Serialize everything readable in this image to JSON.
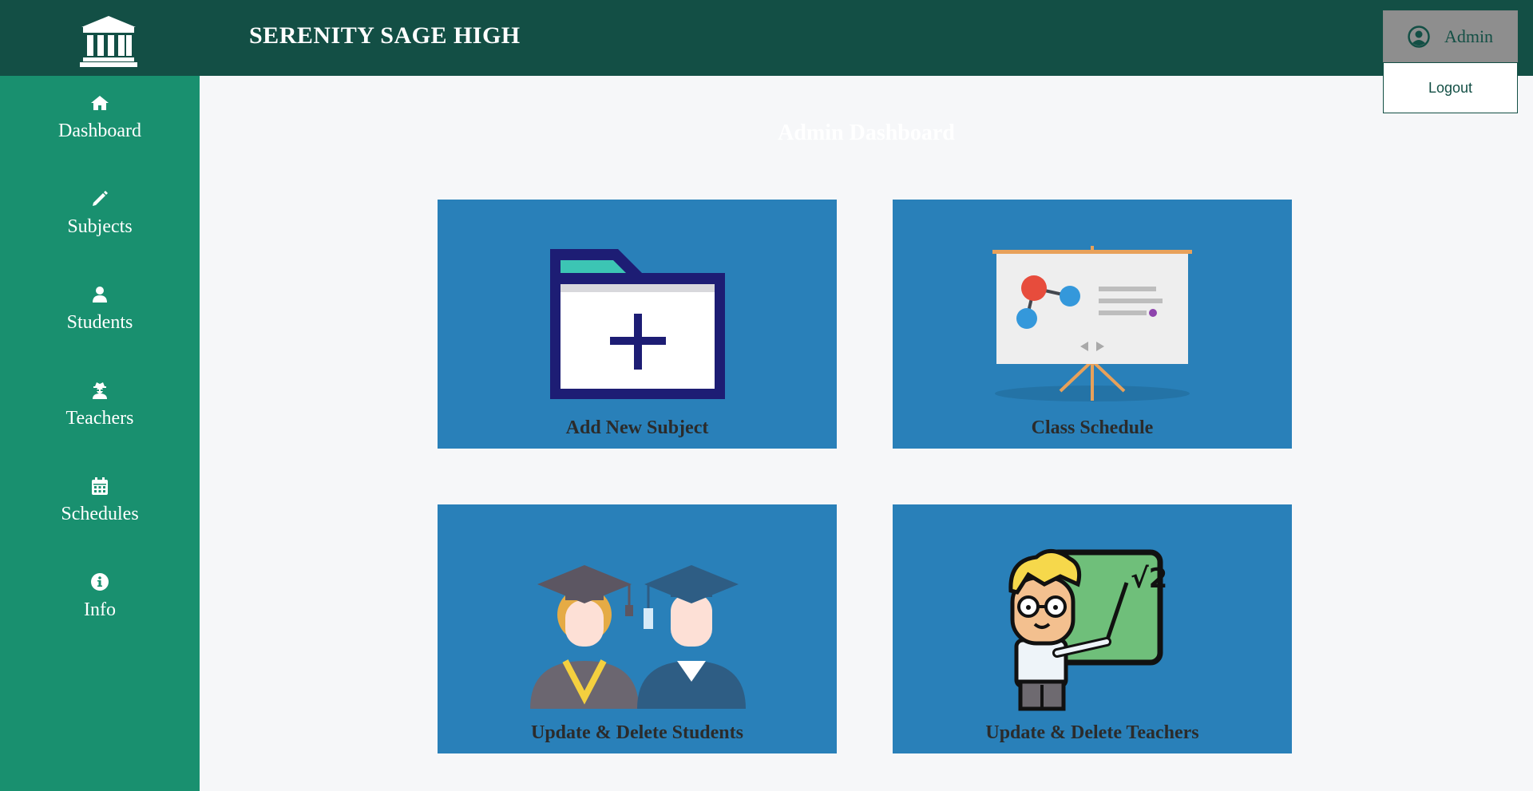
{
  "header": {
    "school_name": "SERENITY SAGE HIGH",
    "user_label": "Admin",
    "logout_label": "Logout",
    "icons": {
      "logo": "bank-building-icon",
      "user": "user-circle-icon"
    }
  },
  "sidebar": {
    "items": [
      {
        "label": "Dashboard",
        "icon": "home-icon"
      },
      {
        "label": "Subjects",
        "icon": "pencil-icon"
      },
      {
        "label": "Students",
        "icon": "user-icon"
      },
      {
        "label": "Teachers",
        "icon": "user-secret-icon"
      },
      {
        "label": "Schedules",
        "icon": "calendar-icon"
      },
      {
        "label": "Info",
        "icon": "info-icon"
      }
    ]
  },
  "main": {
    "title": "Admin Dashboard",
    "cards": [
      {
        "label": "Add New Subject",
        "image": "add-folder-illustration"
      },
      {
        "label": "Class Schedule",
        "image": "presentation-board-illustration"
      },
      {
        "label": "Update & Delete Students",
        "image": "graduates-illustration"
      },
      {
        "label": "Update & Delete Teachers",
        "image": "teacher-chalkboard-illustration"
      }
    ]
  },
  "colors": {
    "header_bg": "#134f45",
    "sidebar_bg": "#19906f",
    "card_bg": "#2980b9",
    "page_bg": "#f6f7f9",
    "admin_button_bg": "#8e8e8e"
  }
}
